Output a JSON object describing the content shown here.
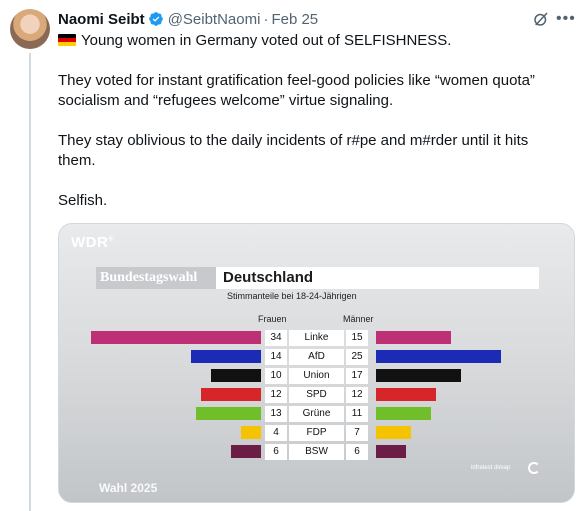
{
  "tweet": {
    "author_name": "Naomi Seibt",
    "handle": "@SeibtNaomi",
    "separator": "·",
    "date": "Feb 25",
    "more_icon": "more-horizontal-icon",
    "grok_icon": "grok-icon",
    "verified_icon": "verified-badge-icon",
    "flag_icon": "germany-flag-icon",
    "lines": {
      "headline": "Young women in Germany voted out of SELFISHNESS.",
      "p1_l1": "They voted for instant gratification feel-good policies like “women quota”",
      "p1_l2": "socialism and “refugees welcome” virtue signaling.",
      "p2_l1": "They stay oblivious to the daily incidents of r#pe and m#rder until it hits",
      "p2_l2": "them.",
      "p3": "Selfish."
    }
  },
  "media": {
    "logo": "WDR",
    "logo_sup": "®",
    "title_left": "Bundestagswahl",
    "title_right": "Deutschland",
    "subtitle": "Stimmanteile bei 18-24-Jährigen",
    "col_left": "Frauen",
    "col_right": "Männer",
    "footer": "Wahl 2025",
    "source": "infratest dimap",
    "chart_data": {
      "type": "bar",
      "categories": [
        "Linke",
        "AfD",
        "Union",
        "SPD",
        "Grüne",
        "FDP",
        "BSW"
      ],
      "series": [
        {
          "name": "Frauen",
          "values": [
            34,
            14,
            10,
            12,
            13,
            4,
            6
          ]
        },
        {
          "name": "Männer",
          "values": [
            15,
            25,
            17,
            12,
            11,
            7,
            6
          ]
        }
      ],
      "colors": [
        "#be3075",
        "#1c2bb5",
        "#111111",
        "#d7262a",
        "#6fbe2a",
        "#f5c300",
        "#6b1d46"
      ]
    }
  }
}
